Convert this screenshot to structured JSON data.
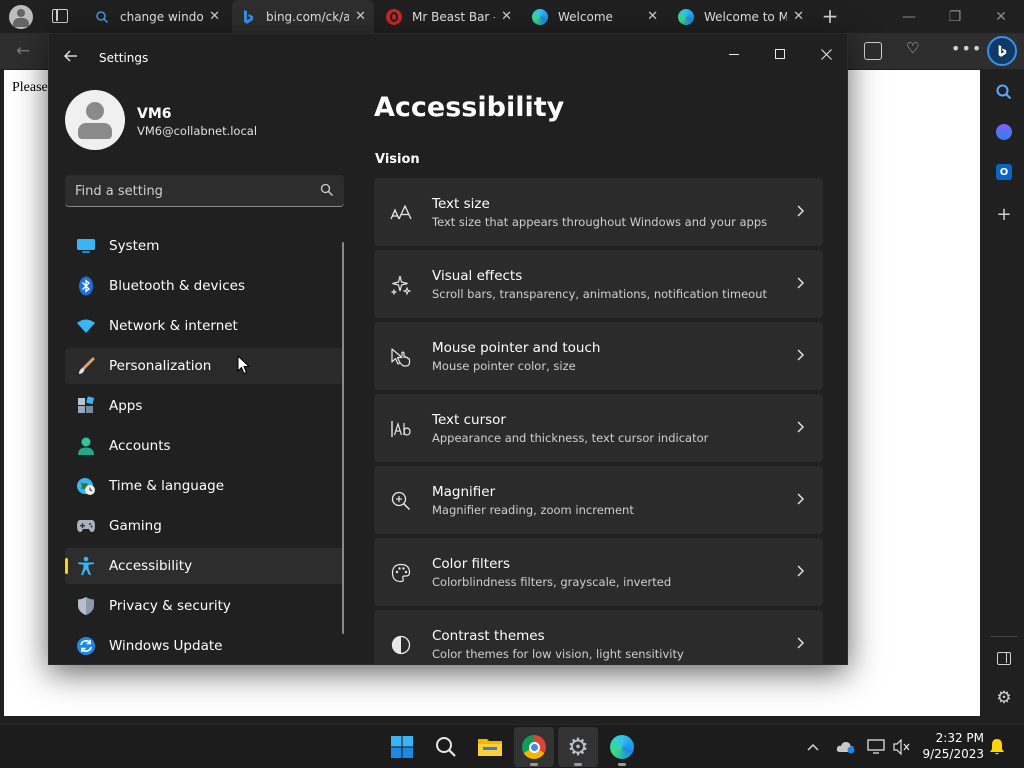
{
  "browser": {
    "tabs": [
      {
        "label": "change windo",
        "favicon": "search-icon"
      },
      {
        "label": "bing.com/ck/a",
        "favicon": "bing-icon"
      },
      {
        "label": "Mr Beast Bar -",
        "favicon": "opera-icon"
      },
      {
        "label": "Welcome",
        "favicon": "edge-icon"
      },
      {
        "label": "Welcome to M",
        "favicon": "edge-icon"
      }
    ],
    "page_text": "Please"
  },
  "settings": {
    "window_title": "Settings",
    "user": {
      "name": "VM6",
      "email": "VM6@collabnet.local"
    },
    "search_placeholder": "Find a setting",
    "nav": [
      {
        "label": "System",
        "icon": "monitor-icon"
      },
      {
        "label": "Bluetooth & devices",
        "icon": "bluetooth-icon"
      },
      {
        "label": "Network & internet",
        "icon": "wifi-icon"
      },
      {
        "label": "Personalization",
        "icon": "brush-icon"
      },
      {
        "label": "Apps",
        "icon": "apps-icon"
      },
      {
        "label": "Accounts",
        "icon": "person-icon"
      },
      {
        "label": "Time & language",
        "icon": "globe-clock-icon"
      },
      {
        "label": "Gaming",
        "icon": "gamepad-icon"
      },
      {
        "label": "Accessibility",
        "icon": "accessibility-icon"
      },
      {
        "label": "Privacy & security",
        "icon": "shield-icon"
      },
      {
        "label": "Windows Update",
        "icon": "update-icon"
      }
    ],
    "selected_nav": "Accessibility",
    "page_title": "Accessibility",
    "section": "Vision",
    "cards": [
      {
        "title": "Text size",
        "desc": "Text size that appears throughout Windows and your apps",
        "icon": "text-size-icon"
      },
      {
        "title": "Visual effects",
        "desc": "Scroll bars, transparency, animations, notification timeout",
        "icon": "sparkle-icon"
      },
      {
        "title": "Mouse pointer and touch",
        "desc": "Mouse pointer color, size",
        "icon": "pointer-touch-icon"
      },
      {
        "title": "Text cursor",
        "desc": "Appearance and thickness, text cursor indicator",
        "icon": "text-cursor-icon"
      },
      {
        "title": "Magnifier",
        "desc": "Magnifier reading, zoom increment",
        "icon": "magnifier-icon"
      },
      {
        "title": "Color filters",
        "desc": "Colorblindness filters, grayscale, inverted",
        "icon": "palette-icon"
      },
      {
        "title": "Contrast themes",
        "desc": "Color themes for low vision, light sensitivity",
        "icon": "contrast-icon"
      }
    ]
  },
  "taskbar": {
    "time": "2:32 PM",
    "date": "9/25/2023"
  },
  "colors": {
    "accent_yellow": "#ffd400",
    "window_bg": "#202020",
    "card_bg": "#2b2b2b"
  }
}
